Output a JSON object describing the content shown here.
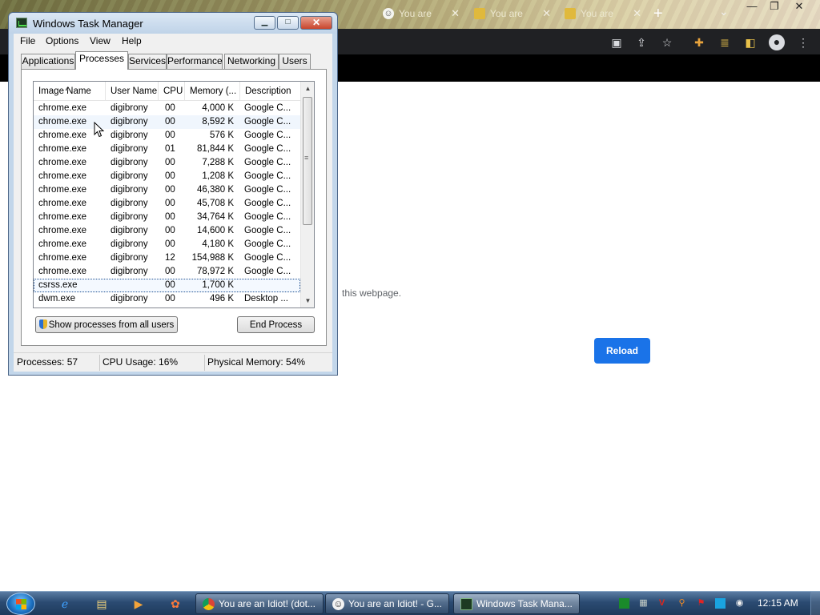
{
  "browser": {
    "tabs": [
      {
        "label": "You are",
        "favicon": "smiley-icon"
      },
      {
        "label": "You are",
        "favicon": "folder-icon"
      },
      {
        "label": "You are",
        "favicon": "folder-icon"
      }
    ],
    "new_tab": "+",
    "page_message": "this webpage.",
    "reload_label": "Reload",
    "accent": "#1a73e8"
  },
  "taskmgr": {
    "title": "Windows Task Manager",
    "menu": [
      "File",
      "Options",
      "View",
      "Help"
    ],
    "tabs": [
      "Applications",
      "Processes",
      "Services",
      "Performance",
      "Networking",
      "Users"
    ],
    "active_tab": "Processes",
    "columns": [
      "Image Name",
      "User Name",
      "CPU",
      "Memory (...",
      "Description"
    ],
    "processes": [
      {
        "image": "chrome.exe",
        "user": "digibrony",
        "cpu": "00",
        "mem": "4,000 K",
        "desc": "Google C..."
      },
      {
        "image": "chrome.exe",
        "user": "digibrony",
        "cpu": "00",
        "mem": "8,592 K",
        "desc": "Google C..."
      },
      {
        "image": "chrome.exe",
        "user": "digibrony",
        "cpu": "00",
        "mem": "576 K",
        "desc": "Google C..."
      },
      {
        "image": "chrome.exe",
        "user": "digibrony",
        "cpu": "01",
        "mem": "81,844 K",
        "desc": "Google C..."
      },
      {
        "image": "chrome.exe",
        "user": "digibrony",
        "cpu": "00",
        "mem": "7,288 K",
        "desc": "Google C..."
      },
      {
        "image": "chrome.exe",
        "user": "digibrony",
        "cpu": "00",
        "mem": "1,208 K",
        "desc": "Google C..."
      },
      {
        "image": "chrome.exe",
        "user": "digibrony",
        "cpu": "00",
        "mem": "46,380 K",
        "desc": "Google C..."
      },
      {
        "image": "chrome.exe",
        "user": "digibrony",
        "cpu": "00",
        "mem": "45,708 K",
        "desc": "Google C..."
      },
      {
        "image": "chrome.exe",
        "user": "digibrony",
        "cpu": "00",
        "mem": "34,764 K",
        "desc": "Google C..."
      },
      {
        "image": "chrome.exe",
        "user": "digibrony",
        "cpu": "00",
        "mem": "14,600 K",
        "desc": "Google C..."
      },
      {
        "image": "chrome.exe",
        "user": "digibrony",
        "cpu": "00",
        "mem": "4,180 K",
        "desc": "Google C..."
      },
      {
        "image": "chrome.exe",
        "user": "digibrony",
        "cpu": "12",
        "mem": "154,988 K",
        "desc": "Google C..."
      },
      {
        "image": "chrome.exe",
        "user": "digibrony",
        "cpu": "00",
        "mem": "78,972 K",
        "desc": "Google C..."
      },
      {
        "image": "csrss.exe",
        "user": "",
        "cpu": "00",
        "mem": "1,700 K",
        "desc": ""
      },
      {
        "image": "dwm.exe",
        "user": "digibrony",
        "cpu": "00",
        "mem": "496 K",
        "desc": "Desktop ..."
      }
    ],
    "hover_row": 1,
    "selected_row": 13,
    "show_all_label": "Show processes from all users",
    "end_process_label": "End Process",
    "status": {
      "processes": "Processes: 57",
      "cpu": "CPU Usage: 16%",
      "memory": "Physical Memory: 54%"
    }
  },
  "taskbar": {
    "buttons": [
      {
        "label": "You are an Idiot! (dot...",
        "icon": "chrome-icon"
      },
      {
        "label": "You are an Idiot! - G...",
        "icon": "smiley-icon"
      },
      {
        "label": "Windows Task Mana...",
        "icon": "taskmgr-icon"
      }
    ],
    "clock": "12:15 AM"
  }
}
